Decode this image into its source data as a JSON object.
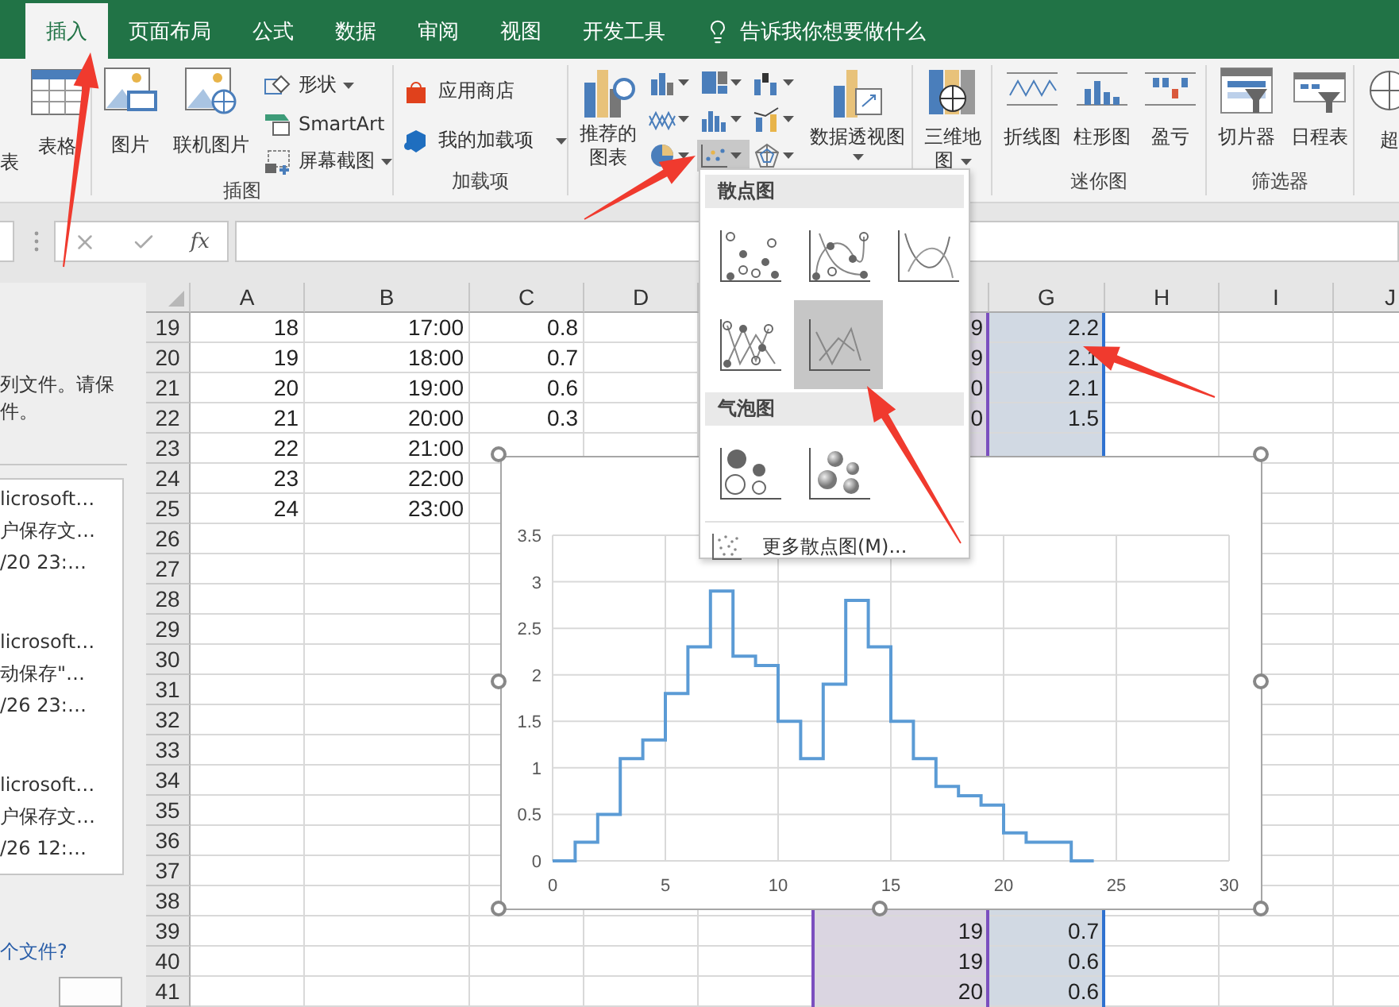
{
  "tabs": [
    {
      "label": "插入",
      "selected": true
    },
    {
      "label": "页面布局",
      "selected": false
    },
    {
      "label": "公式",
      "selected": false
    },
    {
      "label": "数据",
      "selected": false
    },
    {
      "label": "审阅",
      "selected": false
    },
    {
      "label": "视图",
      "selected": false
    },
    {
      "label": "开发工具",
      "selected": false
    }
  ],
  "tell_me": "告诉我你想要做什么",
  "ribbon": {
    "tables": {
      "fragment": "表",
      "table": "表格"
    },
    "illustrations": {
      "label": "插图",
      "large": [
        "图片",
        "联机图片"
      ],
      "small": [
        {
          "label": "形状",
          "dropdown": true
        },
        {
          "label": "SmartArt",
          "dropdown": false
        },
        {
          "label": "屏幕截图",
          "dropdown": true
        }
      ]
    },
    "addins": {
      "label": "加载项",
      "items": [
        {
          "label": "应用商店",
          "dropdown": false
        },
        {
          "label": "我的加载项",
          "dropdown": true
        }
      ]
    },
    "charts": {
      "recommended": [
        "推荐的",
        "图表"
      ],
      "small_buttons": [
        {
          "kind": "column",
          "selected": false
        },
        {
          "kind": "hierarchy",
          "selected": false
        },
        {
          "kind": "waterfall",
          "selected": false
        },
        {
          "kind": "line",
          "selected": false
        },
        {
          "kind": "statistic",
          "selected": false
        },
        {
          "kind": "combo",
          "selected": false
        },
        {
          "kind": "pie",
          "selected": false
        },
        {
          "kind": "scatter",
          "selected": true
        },
        {
          "kind": "radar",
          "selected": false
        }
      ],
      "pivot_chart": "数据透视图"
    },
    "maps": {
      "lines": [
        "三维地",
        "图"
      ]
    },
    "sparklines": {
      "label": "迷你图",
      "items": [
        {
          "kind": "line",
          "label": "折线图"
        },
        {
          "kind": "column",
          "label": "柱形图"
        },
        {
          "kind": "winloss",
          "label": "盈亏"
        }
      ]
    },
    "filters": {
      "label": "筛选器",
      "items": [
        {
          "kind": "slicer",
          "label": "切片器"
        },
        {
          "kind": "timeline",
          "label": "日程表"
        }
      ]
    },
    "links": {
      "item": "超"
    }
  },
  "formula_bar": {
    "function_label": "fx"
  },
  "recovery_pane": {
    "message_lines": [
      "列文件。请保",
      "件。"
    ],
    "files": [
      {
        "lines": [
          "licrosoft…",
          "户保存文…",
          "/20 23:…"
        ]
      },
      {
        "lines": [
          "licrosoft…",
          "动保存\"…",
          "/26 23:…"
        ]
      },
      {
        "lines": [
          "licrosoft…",
          "户保存文…",
          "/26 12:…"
        ]
      }
    ],
    "link": "个文件?"
  },
  "sheet": {
    "columns": [
      {
        "label": "A"
      },
      {
        "label": "B"
      },
      {
        "label": "C"
      },
      {
        "label": "D"
      },
      {},
      {
        "color": "#7b4fbf"
      },
      {
        "label": "G",
        "color": "#2f72d0"
      },
      {
        "label": "H"
      },
      {
        "label": "I"
      },
      {
        "label": "J"
      }
    ],
    "rows": [
      {
        "number": "19",
        "cells": [
          "18",
          "17:00",
          "0.8",
          null,
          null,
          "9",
          "2.2"
        ]
      },
      {
        "number": "20",
        "cells": [
          "19",
          "18:00",
          "0.7",
          null,
          null,
          "9",
          "2.1"
        ]
      },
      {
        "number": "21",
        "cells": [
          "20",
          "19:00",
          "0.6",
          null,
          null,
          "0",
          "2.1"
        ]
      },
      {
        "number": "22",
        "cells": [
          "21",
          "20:00",
          "0.3",
          null,
          null,
          "0",
          "1.5"
        ]
      },
      {
        "number": "23",
        "cells": [
          "22",
          "21:00"
        ]
      },
      {
        "number": "24",
        "cells": [
          "23",
          "22:00"
        ]
      },
      {
        "number": "25",
        "cells": [
          "24",
          "23:00"
        ]
      },
      {
        "number": "26"
      },
      {
        "number": "27"
      },
      {
        "number": "28"
      },
      {
        "number": "29"
      },
      {
        "number": "30"
      },
      {
        "number": "31"
      },
      {
        "number": "32"
      },
      {
        "number": "33"
      },
      {
        "number": "34"
      },
      {
        "number": "35"
      },
      {
        "number": "36"
      },
      {
        "number": "37"
      },
      {
        "number": "38"
      },
      {
        "number": "39",
        "cells": [
          null,
          null,
          null,
          null,
          null,
          "19",
          "0.7"
        ]
      },
      {
        "number": "40",
        "cells": [
          null,
          null,
          null,
          null,
          null,
          "19",
          "0.6"
        ]
      },
      {
        "number": "41",
        "cells": [
          null,
          null,
          null,
          null,
          null,
          "20",
          "0.6"
        ]
      }
    ]
  },
  "chart": {
    "chart_data": {
      "type": "line",
      "grid": true,
      "x": [
        0,
        1,
        1,
        2,
        2,
        3,
        3,
        4,
        4,
        5,
        5,
        6,
        6,
        7,
        7,
        8,
        8,
        9,
        9,
        10,
        10,
        11,
        11,
        12,
        12,
        13,
        13,
        14,
        14,
        15,
        15,
        16,
        16,
        17,
        17,
        18,
        18,
        19,
        19,
        20,
        20,
        21,
        21,
        23,
        23,
        24
      ],
      "series": [
        {
          "color": "#5b9bd5",
          "values": [
            0,
            0,
            0.2,
            0.2,
            0.5,
            0.5,
            1.1,
            1.1,
            1.3,
            1.3,
            1.8,
            1.8,
            2.3,
            2.3,
            2.9,
            2.9,
            2.2,
            2.2,
            2.1,
            2.1,
            1.5,
            1.5,
            1.1,
            1.1,
            1.9,
            1.9,
            2.8,
            2.8,
            2.3,
            2.3,
            1.5,
            1.5,
            1.1,
            1.1,
            0.8,
            0.8,
            0.7,
            0.7,
            0.6,
            0.6,
            0.3,
            0.3,
            0.2,
            0.2,
            0,
            0
          ]
        }
      ],
      "xlim": [
        0,
        30
      ],
      "ylim": [
        0,
        3.5
      ],
      "xticks": [
        0,
        5,
        10,
        15,
        20,
        25,
        30
      ],
      "yticks": [
        0,
        0.5,
        1,
        1.5,
        2,
        2.5,
        3,
        3.5
      ]
    }
  },
  "scatter_menu": {
    "sections": [
      {
        "title": "散点图",
        "items": [
          {
            "kind": "markers",
            "selected": false
          },
          {
            "kind": "smooth_markers",
            "selected": false
          },
          {
            "kind": "smooth",
            "selected": false
          },
          {
            "kind": "straight_markers",
            "selected": false
          },
          {
            "kind": "straight",
            "selected": true
          }
        ]
      },
      {
        "title": "气泡图",
        "items": [
          {
            "kind": "bubble",
            "selected": false
          },
          {
            "kind": "bubble_3d",
            "selected": false
          }
        ]
      }
    ],
    "more": "更多散点图(M)..."
  }
}
